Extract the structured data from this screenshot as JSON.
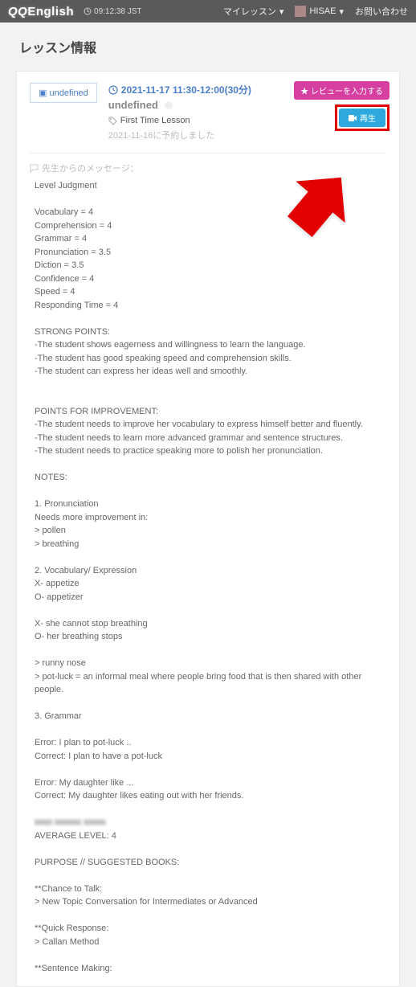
{
  "header": {
    "logo_a": "QQ",
    "logo_b": "English",
    "clock": "09:12:38 JST",
    "nav_lesson": "マイレッスン",
    "nav_user": "HISAE",
    "nav_contact": "お問い合わせ"
  },
  "page": {
    "title": "レッスン情報"
  },
  "lesson": {
    "thumb_text": "undefined",
    "date_line": "2021-11-17 11:30-12:00(30分)",
    "teacher": "undefined",
    "type": "First Time Lesson",
    "booked": "2021-11-16に予約しました",
    "btn_review": "★ レビューを入力する",
    "btn_play": "再生"
  },
  "message": {
    "heading": "先生からのメッセージ：",
    "blur_caption": "xxxx xxxxxx xxxxx",
    "body": "Level Judgment\n\nVocabulary = 4\nComprehension = 4\nGrammar = 4\nPronunciation = 3.5\nDiction = 3.5\nConfidence = 4\nSpeed = 4\nResponding Time = 4\n\nSTRONG POINTS:\n-The student shows eagerness and willingness to learn the language.\n-The student has good speaking speed and comprehension skills.\n-The student can express her ideas well and smoothly.\n\n\nPOINTS FOR IMPROVEMENT:\n-The student needs to improve her vocabulary to express himself better and fluently.\n-The student needs to learn more advanced grammar and sentence structures.\n-The student needs to practice speaking more to polish her pronunciation.\n\nNOTES:\n\n1. Pronunciation\nNeeds more improvement in:\n> pollen\n> breathing\n\n2. Vocabulary/ Expression\nX- appetize\nO- appetizer\n\nX- she cannot stop breathing\nO- her breathing stops\n\n> runny nose\n> pot-luck = an informal meal where people bring food that is then shared with other people.\n\n3. Grammar\n\nError: I plan to pot-luck ..\nCorrect: I plan to have a pot-luck\n\nError: My daughter like ...\nCorrect: My daughter likes eating out with her friends.\n",
    "body2": "\nAVERAGE LEVEL: 4\n\nPURPOSE // SUGGESTED BOOKS:\n\n**Chance to Talk:\n> New Topic Conversation for Intermediates or Advanced\n\n**Quick Response:\n> Callan Method\n\n**Sentence Making:"
  }
}
